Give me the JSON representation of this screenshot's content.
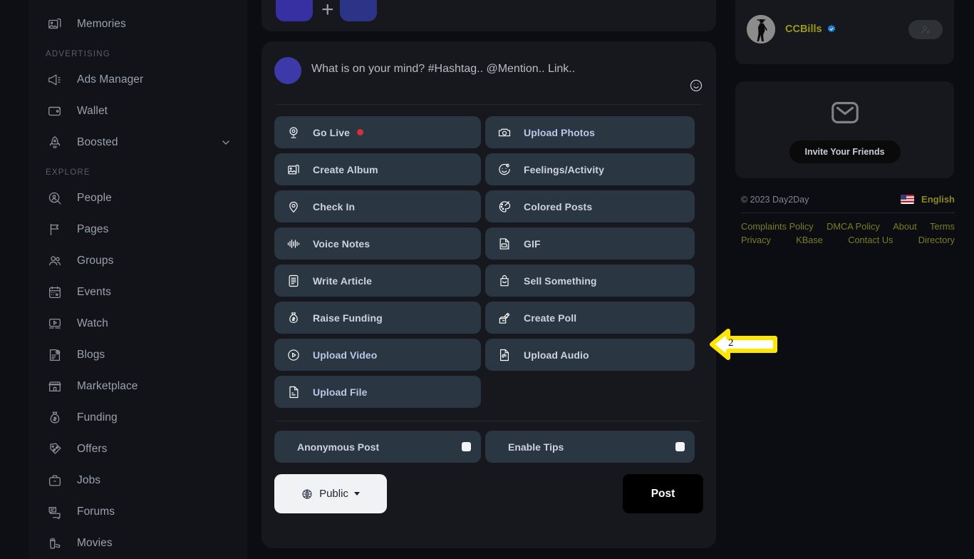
{
  "sidebar": {
    "items_top": [
      {
        "label": "Memories",
        "icon": "memories-icon"
      }
    ],
    "sections": [
      {
        "title": "ADVERTISING",
        "items": [
          {
            "label": "Ads Manager",
            "icon": "megaphone-icon"
          },
          {
            "label": "Wallet",
            "icon": "wallet-icon"
          },
          {
            "label": "Boosted",
            "icon": "rocket-icon",
            "chevron": "chevron-down-icon"
          }
        ]
      },
      {
        "title": "EXPLORE",
        "items": [
          {
            "label": "People",
            "icon": "people-search-icon"
          },
          {
            "label": "Pages",
            "icon": "flag-icon"
          },
          {
            "label": "Groups",
            "icon": "groups-icon"
          },
          {
            "label": "Events",
            "icon": "calendar-icon"
          },
          {
            "label": "Watch",
            "icon": "video-play-icon"
          },
          {
            "label": "Blogs",
            "icon": "blog-icon"
          },
          {
            "label": "Marketplace",
            "icon": "store-icon"
          },
          {
            "label": "Funding",
            "icon": "money-bag-icon"
          },
          {
            "label": "Offers",
            "icon": "tag-percent-icon"
          },
          {
            "label": "Jobs",
            "icon": "briefcase-icon"
          },
          {
            "label": "Forums",
            "icon": "forum-icon"
          },
          {
            "label": "Movies",
            "icon": "movie-icon"
          }
        ]
      }
    ]
  },
  "composer": {
    "placeholder": "What is on your mind? #Hashtag.. @Mention.. Link..",
    "emoji_icon": "smiley-icon",
    "options": [
      {
        "label": "Go Live",
        "icon": "go-live-icon",
        "dot": true,
        "accent": false
      },
      {
        "label": "Upload Photos",
        "icon": "camera-icon",
        "accent": true
      },
      {
        "label": "Create Album",
        "icon": "album-icon",
        "accent": false
      },
      {
        "label": "Feelings/Activity",
        "icon": "feelings-icon",
        "accent": false
      },
      {
        "label": "Check In",
        "icon": "location-pin-icon",
        "accent": false
      },
      {
        "label": "Colored Posts",
        "icon": "palette-icon",
        "accent": false
      },
      {
        "label": "Voice Notes",
        "icon": "waveform-icon",
        "accent": false
      },
      {
        "label": "GIF",
        "icon": "gif-icon",
        "accent": false
      },
      {
        "label": "Write Article",
        "icon": "article-icon",
        "accent": false
      },
      {
        "label": "Sell Something",
        "icon": "shopping-bag-icon",
        "accent": false
      },
      {
        "label": "Raise Funding",
        "icon": "money-bag-icon",
        "accent": false
      },
      {
        "label": "Create Poll",
        "icon": "poll-icon",
        "accent": false
      },
      {
        "label": "Upload Video",
        "icon": "video-circle-icon",
        "accent": true
      },
      {
        "label": "Upload Audio",
        "icon": "audio-file-icon",
        "accent": false
      },
      {
        "label": "Upload File",
        "icon": "file-icon",
        "accent": true
      }
    ],
    "toggles": [
      {
        "label": "Anonymous Post",
        "icon": "incognito-icon",
        "checked": false
      },
      {
        "label": "Enable Tips",
        "icon": "tip-jar-icon",
        "checked": false
      }
    ],
    "privacy": {
      "label": "Public",
      "icon": "globe-icon"
    },
    "post_button": "Post"
  },
  "right": {
    "profile": {
      "name": "CCBills",
      "verified_icon": "verified-badge-icon",
      "avatar_icon": "user-avatar",
      "follow_icon": "add-user-icon"
    },
    "invite": {
      "icon": "envelope-icon",
      "button": "Invite Your Friends"
    },
    "footer": {
      "copyright": "© 2023 Day2Day",
      "language": "English",
      "flag_icon": "us-flag-icon",
      "links_row1": [
        "Complaints Policy",
        "DMCA Policy",
        "About",
        "Terms"
      ],
      "links_row2": [
        "Privacy",
        "KBase",
        "Contact Us",
        "Directory"
      ]
    }
  },
  "annotation": {
    "number": "2"
  },
  "colors": {
    "page_bg": "#0b0d12",
    "sidebar_bg": "#111318",
    "card_bg": "#16181d",
    "tile_bg": "#2b3643",
    "tile_text": "#ccd3de",
    "accent_blue": "#b9c7e8",
    "olive": "#8a8a1c",
    "live_red": "#d32f3c",
    "annotation_yellow": "#ffe600",
    "avatar_blue": "#3b3aa8"
  }
}
